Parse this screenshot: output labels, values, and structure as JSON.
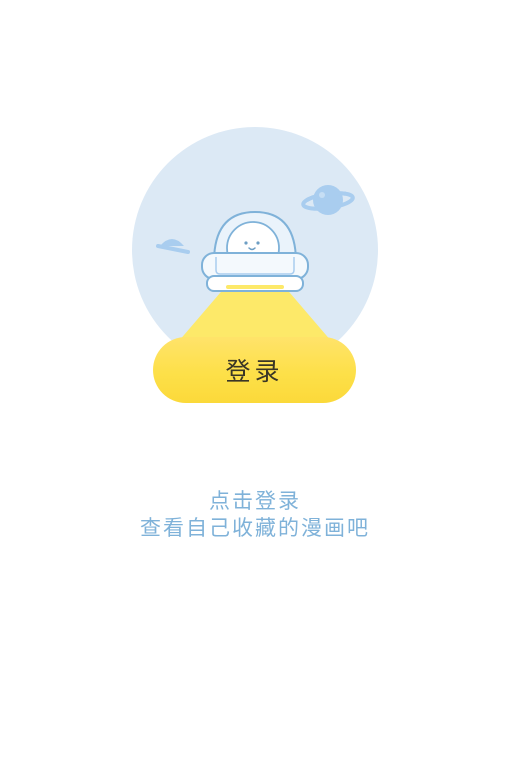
{
  "login": {
    "button_label": "登录"
  },
  "hint": {
    "line1": "点击登录",
    "line2": "查看自己收藏的漫画吧"
  },
  "colors": {
    "circle_bg": "#dce9f5",
    "planet": "#a9cdef",
    "light_beam": "#fdea6a",
    "button": "#fde049",
    "button_text": "#3a3626",
    "hint_text": "#7fb2d9",
    "outline": "#7fb2d9"
  },
  "icons": {
    "astronaut": "astronaut-in-ufo-illustration",
    "planet": "ringed-planet-icon",
    "hat": "small-hat-planet-icon"
  }
}
